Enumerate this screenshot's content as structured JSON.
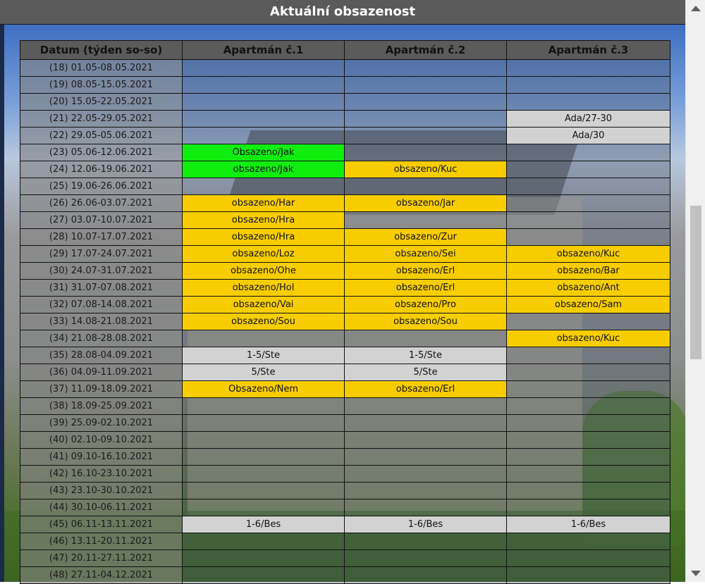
{
  "title": "Aktuální obsazenost",
  "columns": [
    "Datum (týden so-so)",
    "Apartmán č.1",
    "Apartmán č.2",
    "Apartmán č.3"
  ],
  "rows": [
    {
      "date": "(18) 01.05-08.05.2021",
      "cells": [
        {
          "text": "",
          "status": "empty"
        },
        {
          "text": "",
          "status": "empty"
        },
        {
          "text": "",
          "status": "empty"
        }
      ]
    },
    {
      "date": "(19) 08.05-15.05.2021",
      "cells": [
        {
          "text": "",
          "status": "empty"
        },
        {
          "text": "",
          "status": "empty"
        },
        {
          "text": "",
          "status": "empty"
        }
      ]
    },
    {
      "date": "(20) 15.05-22.05.2021",
      "cells": [
        {
          "text": "",
          "status": "empty"
        },
        {
          "text": "",
          "status": "empty"
        },
        {
          "text": "",
          "status": "empty"
        }
      ]
    },
    {
      "date": "(21) 22.05-29.05.2021",
      "cells": [
        {
          "text": "",
          "status": "empty"
        },
        {
          "text": "",
          "status": "empty"
        },
        {
          "text": "Ada/27-30",
          "status": "gray"
        }
      ]
    },
    {
      "date": "(22) 29.05-05.06.2021",
      "cells": [
        {
          "text": "",
          "status": "empty"
        },
        {
          "text": "",
          "status": "empty"
        },
        {
          "text": "Ada/30",
          "status": "gray"
        }
      ]
    },
    {
      "date": "(23) 05.06-12.06.2021",
      "cells": [
        {
          "text": "Obsazeno/Jak",
          "status": "green"
        },
        {
          "text": "",
          "status": "empty"
        },
        {
          "text": "",
          "status": "empty"
        }
      ]
    },
    {
      "date": "(24) 12.06-19.06.2021",
      "cells": [
        {
          "text": "obsazeno/Jak",
          "status": "green"
        },
        {
          "text": "obsazeno/Kuc",
          "status": "yellow"
        },
        {
          "text": "",
          "status": "empty"
        }
      ]
    },
    {
      "date": "(25) 19.06-26.06.2021",
      "cells": [
        {
          "text": "",
          "status": "empty"
        },
        {
          "text": "",
          "status": "empty"
        },
        {
          "text": "",
          "status": "empty"
        }
      ]
    },
    {
      "date": "(26) 26.06-03.07.2021",
      "cells": [
        {
          "text": "obsazeno/Har",
          "status": "yellow"
        },
        {
          "text": "obsazeno/Jar",
          "status": "yellow"
        },
        {
          "text": "",
          "status": "empty"
        }
      ]
    },
    {
      "date": "(27) 03.07-10.07.2021",
      "cells": [
        {
          "text": "obsazeno/Hra",
          "status": "yellow"
        },
        {
          "text": "",
          "status": "empty"
        },
        {
          "text": "",
          "status": "empty"
        }
      ]
    },
    {
      "date": "(28) 10.07-17.07.2021",
      "cells": [
        {
          "text": "obsazeno/Hra",
          "status": "yellow"
        },
        {
          "text": "obsazeno/Zur",
          "status": "yellow"
        },
        {
          "text": "",
          "status": "empty"
        }
      ]
    },
    {
      "date": "(29) 17.07-24.07.2021",
      "cells": [
        {
          "text": "obsazeno/Loz",
          "status": "yellow"
        },
        {
          "text": "obsazeno/Sei",
          "status": "yellow"
        },
        {
          "text": "obsazeno/Kuc",
          "status": "yellow"
        }
      ]
    },
    {
      "date": "(30) 24.07-31.07.2021",
      "cells": [
        {
          "text": "obsazeno/Ohe",
          "status": "yellow"
        },
        {
          "text": "obsazeno/Erl",
          "status": "yellow"
        },
        {
          "text": "obsazeno/Bar",
          "status": "yellow"
        }
      ]
    },
    {
      "date": "(31) 31.07-07.08.2021",
      "cells": [
        {
          "text": "obsazeno/Hol",
          "status": "yellow"
        },
        {
          "text": "obsazeno/Erl",
          "status": "yellow"
        },
        {
          "text": "obsazeno/Ant",
          "status": "yellow"
        }
      ]
    },
    {
      "date": "(32) 07.08-14.08.2021",
      "cells": [
        {
          "text": "obsazeno/Vai",
          "status": "yellow"
        },
        {
          "text": "obsazeno/Pro",
          "status": "yellow"
        },
        {
          "text": "obsazeno/Sam",
          "status": "yellow"
        }
      ]
    },
    {
      "date": "(33) 14.08-21.08.2021",
      "cells": [
        {
          "text": "obsazeno/Sou",
          "status": "yellow"
        },
        {
          "text": "obsazeno/Sou",
          "status": "yellow"
        },
        {
          "text": "",
          "status": "empty"
        }
      ]
    },
    {
      "date": "(34) 21.08-28.08.2021",
      "cells": [
        {
          "text": "",
          "status": "empty"
        },
        {
          "text": "",
          "status": "empty"
        },
        {
          "text": "obsazeno/Kuc",
          "status": "yellow"
        }
      ]
    },
    {
      "date": "(35) 28.08-04.09.2021",
      "cells": [
        {
          "text": "1-5/Ste",
          "status": "gray"
        },
        {
          "text": "1-5/Ste",
          "status": "gray"
        },
        {
          "text": "",
          "status": "empty"
        }
      ]
    },
    {
      "date": "(36) 04.09-11.09.2021",
      "cells": [
        {
          "text": "5/Ste",
          "status": "gray"
        },
        {
          "text": "5/Ste",
          "status": "gray"
        },
        {
          "text": "",
          "status": "empty"
        }
      ]
    },
    {
      "date": "(37) 11.09-18.09.2021",
      "cells": [
        {
          "text": "Obsazeno/Nem",
          "status": "yellow"
        },
        {
          "text": "obsazeno/Erl",
          "status": "yellow"
        },
        {
          "text": "",
          "status": "empty"
        }
      ]
    },
    {
      "date": "(38) 18.09-25.09.2021",
      "cells": [
        {
          "text": "",
          "status": "empty"
        },
        {
          "text": "",
          "status": "empty"
        },
        {
          "text": "",
          "status": "empty"
        }
      ]
    },
    {
      "date": "(39) 25.09-02.10.2021",
      "cells": [
        {
          "text": "",
          "status": "empty"
        },
        {
          "text": "",
          "status": "empty"
        },
        {
          "text": "",
          "status": "empty"
        }
      ]
    },
    {
      "date": "(40) 02.10-09.10.2021",
      "cells": [
        {
          "text": "",
          "status": "empty"
        },
        {
          "text": "",
          "status": "empty"
        },
        {
          "text": "",
          "status": "empty"
        }
      ]
    },
    {
      "date": "(41) 09.10-16.10.2021",
      "cells": [
        {
          "text": "",
          "status": "empty"
        },
        {
          "text": "",
          "status": "empty"
        },
        {
          "text": "",
          "status": "empty"
        }
      ]
    },
    {
      "date": "(42) 16.10-23.10.2021",
      "cells": [
        {
          "text": "",
          "status": "empty"
        },
        {
          "text": "",
          "status": "empty"
        },
        {
          "text": "",
          "status": "empty"
        }
      ]
    },
    {
      "date": "(43) 23.10-30.10.2021",
      "cells": [
        {
          "text": "",
          "status": "empty"
        },
        {
          "text": "",
          "status": "empty"
        },
        {
          "text": "",
          "status": "empty"
        }
      ]
    },
    {
      "date": "(44) 30.10-06.11.2021",
      "cells": [
        {
          "text": "",
          "status": "empty"
        },
        {
          "text": "",
          "status": "empty"
        },
        {
          "text": "",
          "status": "empty"
        }
      ]
    },
    {
      "date": "(45) 06.11-13.11.2021",
      "cells": [
        {
          "text": "1-6/Bes",
          "status": "gray"
        },
        {
          "text": "1-6/Bes",
          "status": "gray"
        },
        {
          "text": "1-6/Bes",
          "status": "gray"
        }
      ]
    },
    {
      "date": "(46) 13.11-20.11.2021",
      "cells": [
        {
          "text": "",
          "status": "empty"
        },
        {
          "text": "",
          "status": "empty"
        },
        {
          "text": "",
          "status": "empty"
        }
      ]
    },
    {
      "date": "(47) 20.11-27.11.2021",
      "cells": [
        {
          "text": "",
          "status": "empty"
        },
        {
          "text": "",
          "status": "empty"
        },
        {
          "text": "",
          "status": "empty"
        }
      ]
    },
    {
      "date": "(48) 27.11-04.12.2021",
      "cells": [
        {
          "text": "",
          "status": "empty"
        },
        {
          "text": "",
          "status": "empty"
        },
        {
          "text": "",
          "status": "empty"
        }
      ]
    }
  ],
  "status_colors": {
    "yellow": "#f7cd00",
    "green": "#10ee10",
    "gray": "#d2d2d2",
    "empty": "transparent"
  },
  "icons": {
    "scroll_up": "triangle-up-icon",
    "scroll_down": "triangle-down-icon"
  }
}
